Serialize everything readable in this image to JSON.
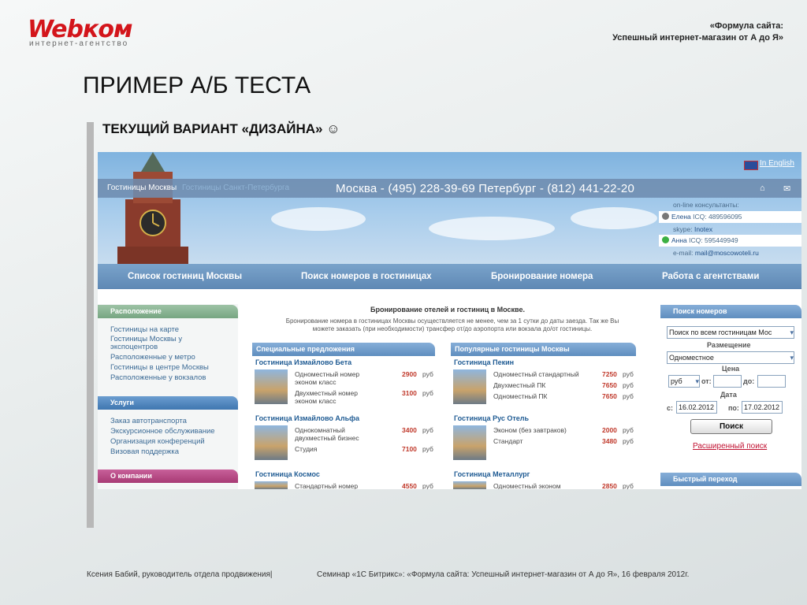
{
  "slide": {
    "logo_main": "Webком",
    "logo_sub": "интернет-агентство",
    "header_line1": "«Формула сайта:",
    "header_line2": "Успешный интернет-магазин от А до Я»",
    "title": "ПРИМЕР А/Б ТЕСТА",
    "subtitle": "ТЕКУЩИЙ ВАРИАНТ «ДИЗАЙНА» ☺",
    "footer_left": "Ксения Бабий, руководитель отдела продвижения|",
    "footer_right": "Семинар «1С Битрикс»: «Формула сайта: Успешный интернет-магазин от А до Я»,  16 февраля 2012г."
  },
  "site": {
    "lang": "In English",
    "top_links": [
      "Гостиницы Москвы",
      "Гостиницы Санкт-Петербурга"
    ],
    "phones": "Москва - (495) 228-39-69   Петербург - (812) 441-22-20",
    "consultants": {
      "title": "on-line консультанты:",
      "c1_name": "Елена",
      "c1_icq": "ICQ: 489596095",
      "skype_label": "skype:",
      "skype_value": "Inotex",
      "c2_name": "Анна",
      "c2_icq": "ICQ: 595449949",
      "email_label": "e-mail:",
      "email_value": "mail@moscowoteli.ru"
    },
    "nav": [
      "Список гостиниц Москвы",
      "Поиск номеров в гостиницах",
      "Бронирование номера",
      "Работа с агентствами"
    ],
    "sidebar": {
      "location_title": "Расположение",
      "location_links": [
        "Гостиницы на карте",
        "Гостиницы Москвы у",
        "экспоцентров",
        "Расположенные у метро",
        "Гостиницы в центре Москвы",
        "Расположенные у вокзалов"
      ],
      "services_title": "Услуги",
      "services_links": [
        "Заказ автотранспорта",
        "Экскурсионное обслуживание",
        "Организация конференций",
        "Визовая поддержка"
      ],
      "about_title": "О компании"
    },
    "center": {
      "title": "Бронирование отелей и гостиниц в Москве.",
      "text1": "Бронирование номера в гостиницах Москвы осуществляется не менее, чем за 1 сутки до даты заезда. Так же Вы",
      "text2": "можете заказать (при необходимости) трансфер от/до аэропорта или вокзала до/от гостиницы.",
      "special_title": "Специальные предложения",
      "popular_title": "Популярные гостиницы Москвы",
      "rub": "руб",
      "left": [
        {
          "name": "Гостиница Измайлово Бета",
          "rooms": [
            [
              "Одноместный номер эконом",
              "класс",
              "2900"
            ],
            [
              "Двухместный номер эконом",
              "класс",
              "3100"
            ]
          ]
        },
        {
          "name": "Гостиница Измайлово Альфа",
          "rooms": [
            [
              "Однокомнатный",
              "двухместный бизнес",
              "3400"
            ],
            [
              "Студия",
              "",
              "7100"
            ]
          ]
        },
        {
          "name": "Гостиница Космос",
          "rooms": [
            [
              "Стандартный номер",
              "",
              "4550"
            ]
          ]
        }
      ],
      "right": [
        {
          "name": "Гостиница Пекин",
          "rooms": [
            [
              "Одноместный стандартный",
              "",
              "7250"
            ],
            [
              "Двухместный ПК",
              "",
              "7650"
            ],
            [
              "Одноместный ПК",
              "",
              "7650"
            ]
          ]
        },
        {
          "name": "Гостиница Рус Отель",
          "rooms": [
            [
              "Эконом (без завтраков)",
              "",
              "2000"
            ],
            [
              "Стандарт",
              "",
              "3480"
            ]
          ]
        },
        {
          "name": "Гостиница Металлург",
          "rooms": [
            [
              "Одноместный эконом",
              "",
              "2850"
            ]
          ]
        }
      ]
    },
    "search": {
      "title": "Поиск номеров",
      "hotel_select": "Поиск по всем гостиницам Мос",
      "placement_label": "Размещение",
      "placement_select": "Одноместное",
      "price_label": "Цена",
      "currency": "руб",
      "from_label": "от:",
      "to_label": "до:",
      "date_label": "Дата",
      "date_from_label": "с:",
      "date_from": "16.02.2012",
      "date_to_label": "по:",
      "date_to": "17.02.2012",
      "button": "Поиск",
      "advanced": "Расширенный поиск",
      "quick_title": "Быстрый переход"
    }
  },
  "colors": {
    "logo": "#d3151b",
    "nav": "#6a94bf",
    "green": "#7fa98a",
    "services": "#4f86bd",
    "about": "#b5477f",
    "link_red": "#c01030"
  }
}
